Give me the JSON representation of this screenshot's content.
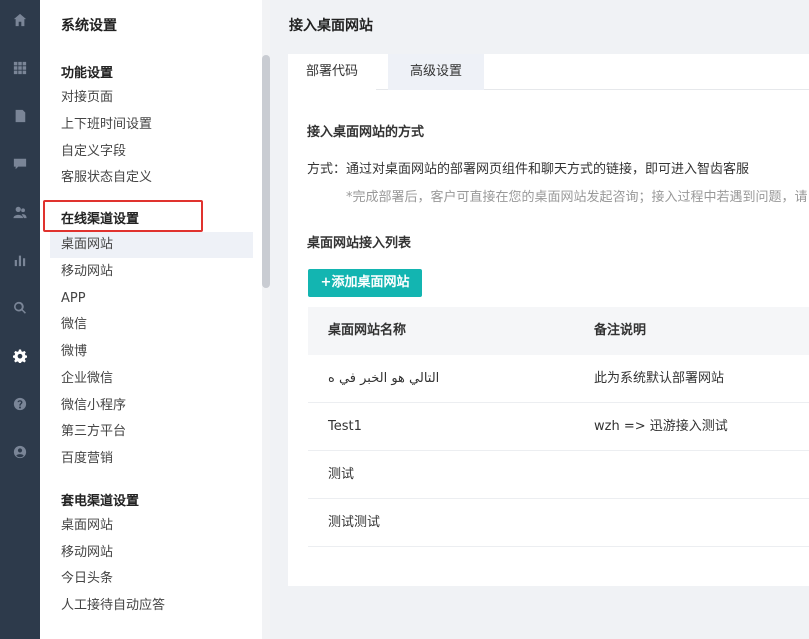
{
  "rail": {
    "icons": [
      "home-icon",
      "apps-icon",
      "document-icon",
      "chat-icon",
      "users-icon",
      "chart-icon",
      "search-icon",
      "settings-icon",
      "help-icon",
      "account-icon"
    ],
    "active": "settings-icon"
  },
  "sidebar": {
    "title": "系统设置",
    "groups": [
      {
        "label": "功能设置",
        "items": [
          "对接页面",
          "上下班时间设置",
          "自定义字段",
          "客服状态自定义"
        ]
      },
      {
        "label": "在线渠道设置",
        "items": [
          "桌面网站",
          "移动网站",
          "APP",
          "微信",
          "微博",
          "企业微信",
          "微信小程序",
          "第三方平台",
          "百度营销"
        ]
      },
      {
        "label": "套电渠道设置",
        "items": [
          "桌面网站",
          "移动网站",
          "今日头条",
          "人工接待自动应答"
        ]
      }
    ],
    "active_item": "桌面网站",
    "highlight_color": "#e0322e"
  },
  "main": {
    "title": "接入桌面网站",
    "tabs": [
      {
        "label": "部署代码",
        "active": true
      },
      {
        "label": "高级设置",
        "active": false
      }
    ],
    "method_section_label": "接入桌面网站的方式",
    "method_text": "方式：通过对桌面网站的部署网页组件和聊天方式的链接，即可进入智齿客服",
    "note_text": "*完成部署后，客户可直接在您的桌面网站发起咨询；接入过程中若遇到问题，请",
    "list_section_label": "桌面网站接入列表",
    "add_button_label": "+添加桌面网站",
    "accent_color": "#13b5b1",
    "table": {
      "columns": [
        "桌面网站名称",
        "备注说明"
      ],
      "rows": [
        [
          "التالي هو الخبر في ه",
          "此为系统默认部署网站"
        ],
        [
          "Test1",
          "wzh => 迅游接入测试"
        ],
        [
          "测试",
          ""
        ],
        [
          "测试测试",
          ""
        ]
      ]
    }
  }
}
